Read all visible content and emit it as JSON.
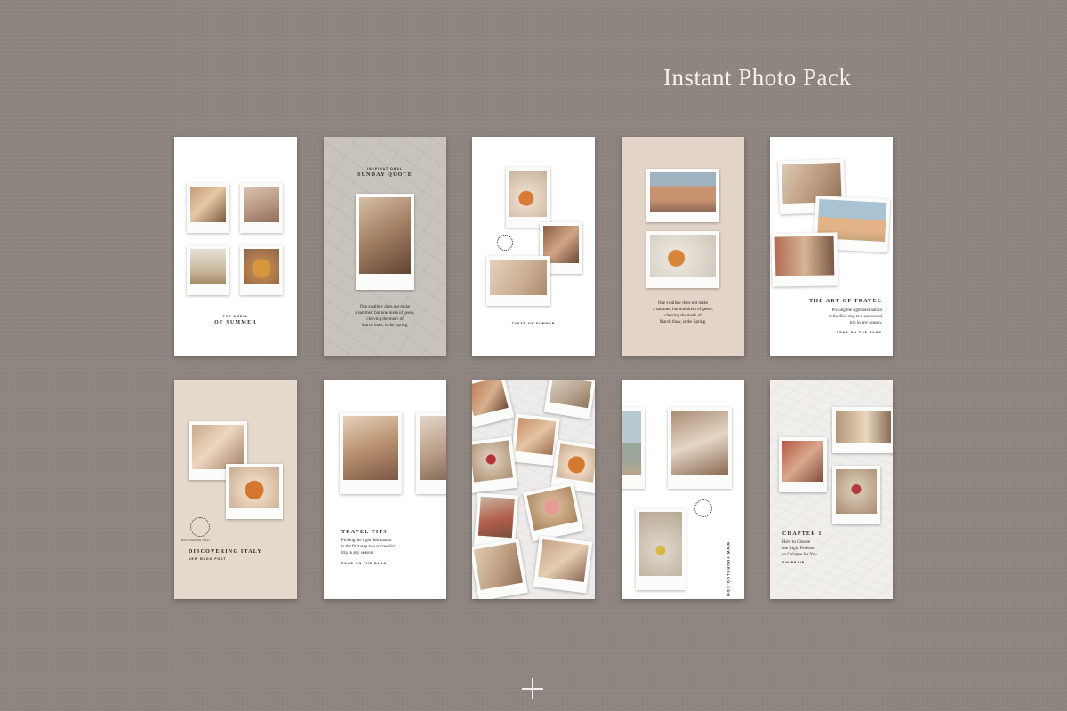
{
  "header": {
    "title": "Instant Photo Pack"
  },
  "cards": [
    {
      "id": 1,
      "title_line1": "THE SMELL",
      "title_line2": "OF SUMMER"
    },
    {
      "id": 2,
      "kicker": "INSPIRATIONAL",
      "title": "SUNDAY QUOTE",
      "body": "One swallow does not make\na summer, but one skein of geese,\ncleaving the murk of\nMarch thaw, is the Spring."
    },
    {
      "id": 3,
      "title": "TASTE OF SUMMER"
    },
    {
      "id": 4,
      "body": "One swallow does not make\na summer, but one skein of geese,\ncleaving the murk of\nMarch thaw, is the Spring."
    },
    {
      "id": 5,
      "title": "THE ART OF TRAVEL",
      "body": "Picking the right destination\nis the first step to a successful\ntrip in any season.",
      "cta": "READ ON THE BLOG"
    },
    {
      "id": 6,
      "title": "DISCOVERING ITALY",
      "subtitle": "NEW BLOG POST",
      "stamp": "DISCOVERING ITALY"
    },
    {
      "id": 7,
      "title": "TRAVEL TIPS",
      "body": "Picking the right destination\nis the first step to a successful\ntrip in any season.",
      "cta": "READ ON THE BLOG"
    },
    {
      "id": 8
    },
    {
      "id": 9,
      "vertical": "WWW.YOURBLOG.COM"
    },
    {
      "id": 10,
      "title": "CHAPTER 1",
      "body": "How to Choose\nthe Right Perfume\nor Cologne for You",
      "cta": "SWIPE UP"
    }
  ],
  "colors": {
    "background": "#8e847e",
    "card_white": "#ffffff",
    "card_gray": "#c9c3bd",
    "card_beige": "#e2d4c7",
    "text_dark": "#2e2724"
  }
}
